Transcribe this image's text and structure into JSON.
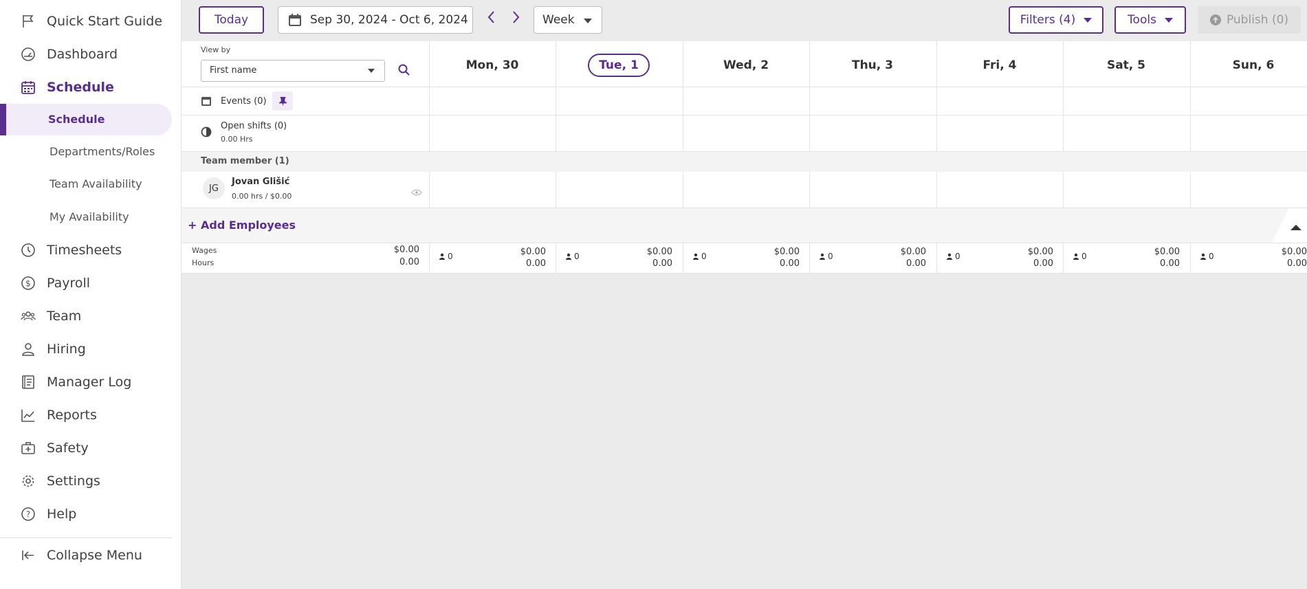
{
  "sidebar": {
    "items": [
      {
        "label": "Quick Start Guide",
        "icon": "flag-icon"
      },
      {
        "label": "Dashboard",
        "icon": "dashboard-icon"
      },
      {
        "label": "Schedule",
        "icon": "calendar-icon",
        "active": true
      },
      {
        "label": "Timesheets",
        "icon": "clock-icon"
      },
      {
        "label": "Payroll",
        "icon": "dollar-icon"
      },
      {
        "label": "Team",
        "icon": "team-icon"
      },
      {
        "label": "Hiring",
        "icon": "person-icon"
      },
      {
        "label": "Manager Log",
        "icon": "log-icon"
      },
      {
        "label": "Reports",
        "icon": "chart-icon"
      },
      {
        "label": "Safety",
        "icon": "medkit-icon"
      },
      {
        "label": "Settings",
        "icon": "gear-icon"
      },
      {
        "label": "Help",
        "icon": "help-icon"
      }
    ],
    "subitems": [
      {
        "label": "Schedule",
        "selected": true
      },
      {
        "label": "Departments/Roles"
      },
      {
        "label": "Team Availability"
      },
      {
        "label": "My Availability"
      }
    ],
    "collapse_label": "Collapse Menu"
  },
  "toolbar": {
    "today_label": "Today",
    "date_range": "Sep 30, 2024 - Oct 6, 2024",
    "view_value": "Week",
    "filters_label": "Filters (4)",
    "tools_label": "Tools",
    "publish_label": "Publish (0)"
  },
  "grid": {
    "view_by_label": "View by",
    "view_by_value": "First name",
    "events_label": "Events (0)",
    "open_shifts_label": "Open shifts (0)",
    "open_shifts_hours": "0.00 Hrs",
    "team_member_label": "Team member (1)",
    "employee": {
      "initials": "JG",
      "name": "Jovan Glišić",
      "stats": "0.00 hrs / $0.00"
    },
    "add_employees_label": "+ Add Employees",
    "wages_label": "Wages",
    "hours_label": "Hours",
    "totals": {
      "wages": "$0.00",
      "hours": "0.00"
    },
    "days": [
      {
        "label": "Mon, 30",
        "count": "0",
        "wages": "$0.00",
        "hours": "0.00",
        "today": false
      },
      {
        "label": "Tue, 1",
        "count": "0",
        "wages": "$0.00",
        "hours": "0.00",
        "today": true
      },
      {
        "label": "Wed, 2",
        "count": "0",
        "wages": "$0.00",
        "hours": "0.00",
        "today": false
      },
      {
        "label": "Thu, 3",
        "count": "0",
        "wages": "$0.00",
        "hours": "0.00",
        "today": false
      },
      {
        "label": "Fri, 4",
        "count": "0",
        "wages": "$0.00",
        "hours": "0.00",
        "today": false
      },
      {
        "label": "Sat, 5",
        "count": "0",
        "wages": "$0.00",
        "hours": "0.00",
        "today": false
      },
      {
        "label": "Sun, 6",
        "count": "0",
        "wages": "$0.00",
        "hours": "0.00",
        "today": false
      }
    ]
  },
  "colors": {
    "accent": "#5a2d91",
    "background": "#ebebeb"
  }
}
